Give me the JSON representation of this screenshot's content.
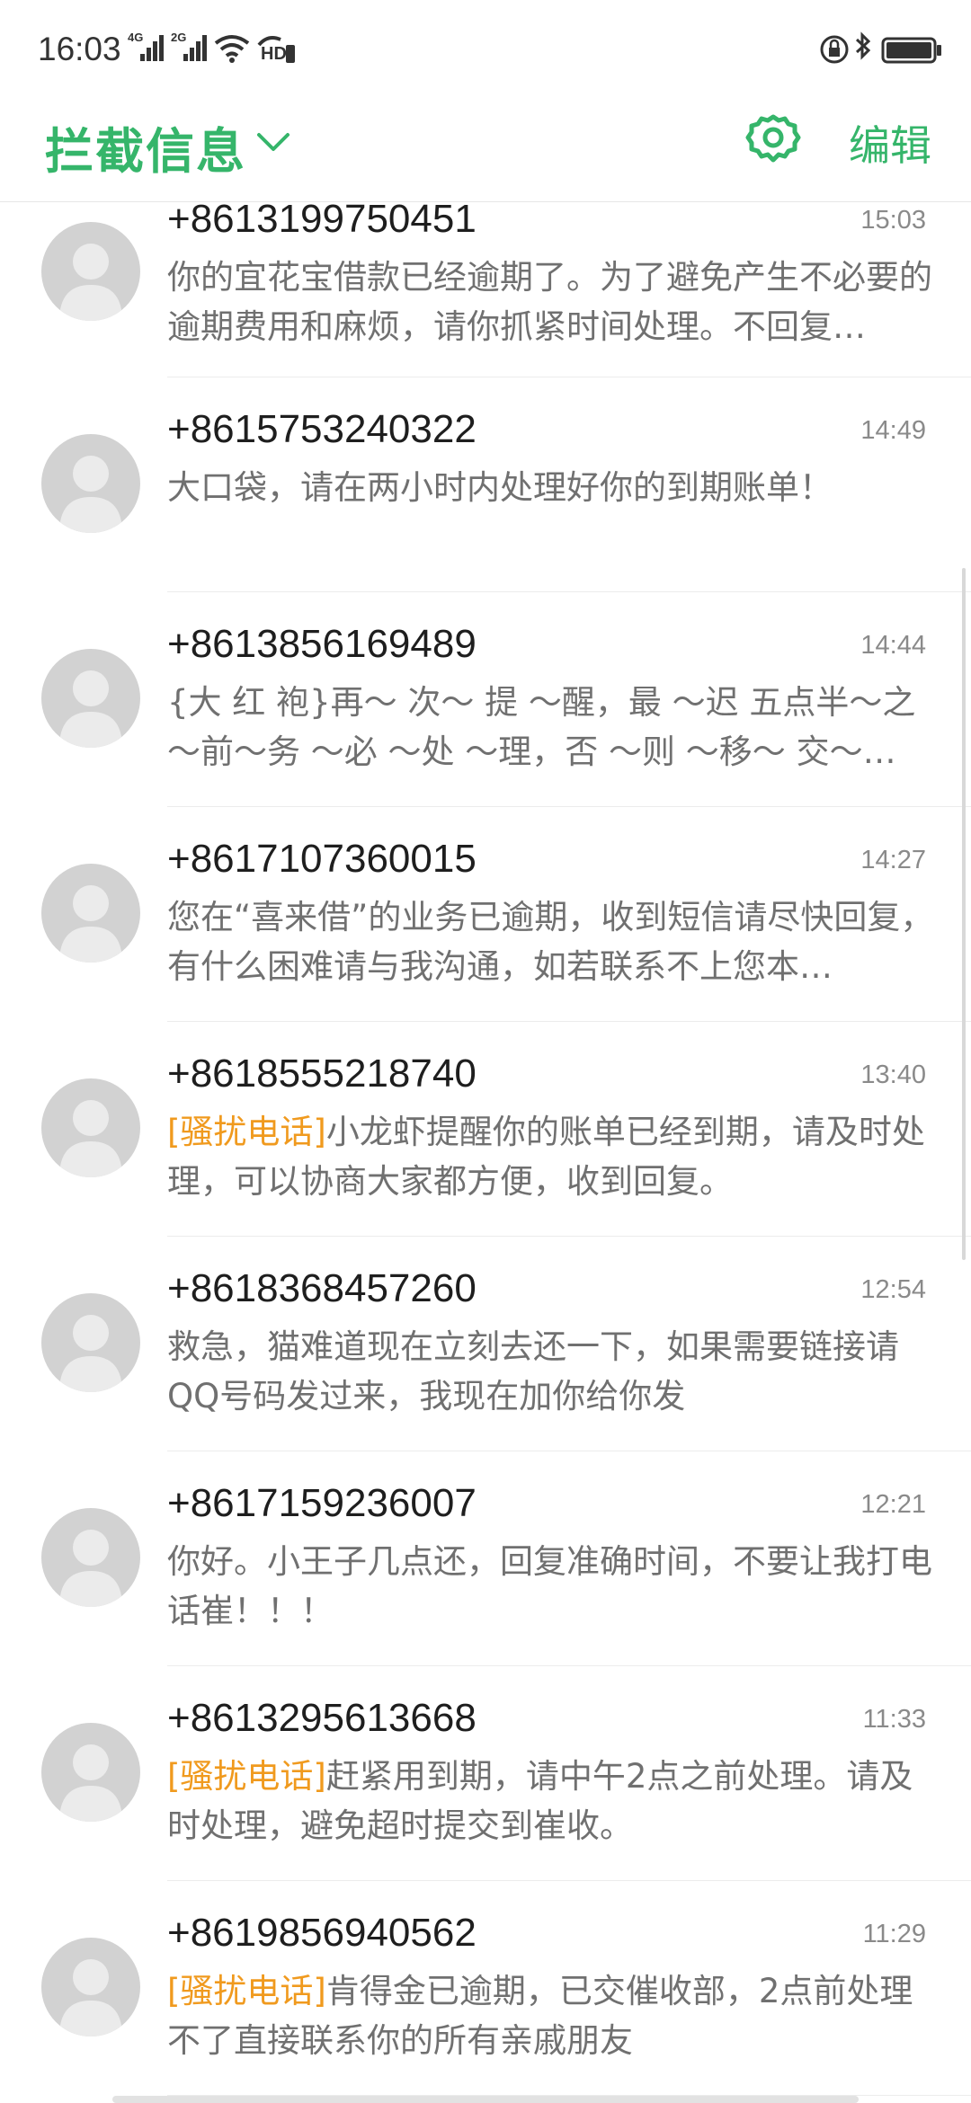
{
  "status_bar": {
    "time": "16:03",
    "sim1_label": "4G",
    "sim2_label": "2G",
    "hd_label": "HD"
  },
  "header": {
    "title": "拦截信息",
    "edit_label": "编辑",
    "accent_color": "#35b56a"
  },
  "messages": [
    {
      "sender": "+8613199750451",
      "time": "15:03",
      "tag": "",
      "preview": "你的宜花宝借款已经逾期了。为了避免产生不必要的逾期费用和麻烦，请你抓紧时间处理。不回复…"
    },
    {
      "sender": "+8615753240322",
      "time": "14:49",
      "tag": "",
      "preview": "大口袋，请在两小时内处理好你的到期账单！"
    },
    {
      "sender": "+8613856169489",
      "time": "14:44",
      "tag": "",
      "preview": "{大 红 袍}再～ 次～ 提 ～醒，最 ～迟 五点半～之～前～务 ～必 ～处 ～理，否 ～则 ～移～ 交～…"
    },
    {
      "sender": "+8617107360015",
      "time": "14:27",
      "tag": "",
      "preview": "您在“喜来借”的业务已逾期，收到短信请尽快回复，有什么困难请与我沟通，如若联系不上您本…"
    },
    {
      "sender": "+8618555218740",
      "time": "13:40",
      "tag": "[骚扰电话]",
      "preview": "小龙虾提醒你的账单已经到期，请及时处理，可以协商大家都方便，收到回复。"
    },
    {
      "sender": "+8618368457260",
      "time": "12:54",
      "tag": "",
      "preview": "救急，猫难道现在立刻去还一下，如果需要链接请QQ号码发过来，我现在加你给你发"
    },
    {
      "sender": "+8617159236007",
      "time": "12:21",
      "tag": "",
      "preview": "你好。小王子几点还，回复准确时间，不要让我打电话崔！！！"
    },
    {
      "sender": "+8613295613668",
      "time": "11:33",
      "tag": "[骚扰电话]",
      "preview": "赶紧用到期，请中午2点之前处理。请及时处理，避免超时提交到崔收。"
    },
    {
      "sender": "+8619856940562",
      "time": "11:29",
      "tag": "[骚扰电话]",
      "preview": "肯得金已逾期，已交催收部，2点前处理不了直接联系你的所有亲戚朋友"
    }
  ]
}
